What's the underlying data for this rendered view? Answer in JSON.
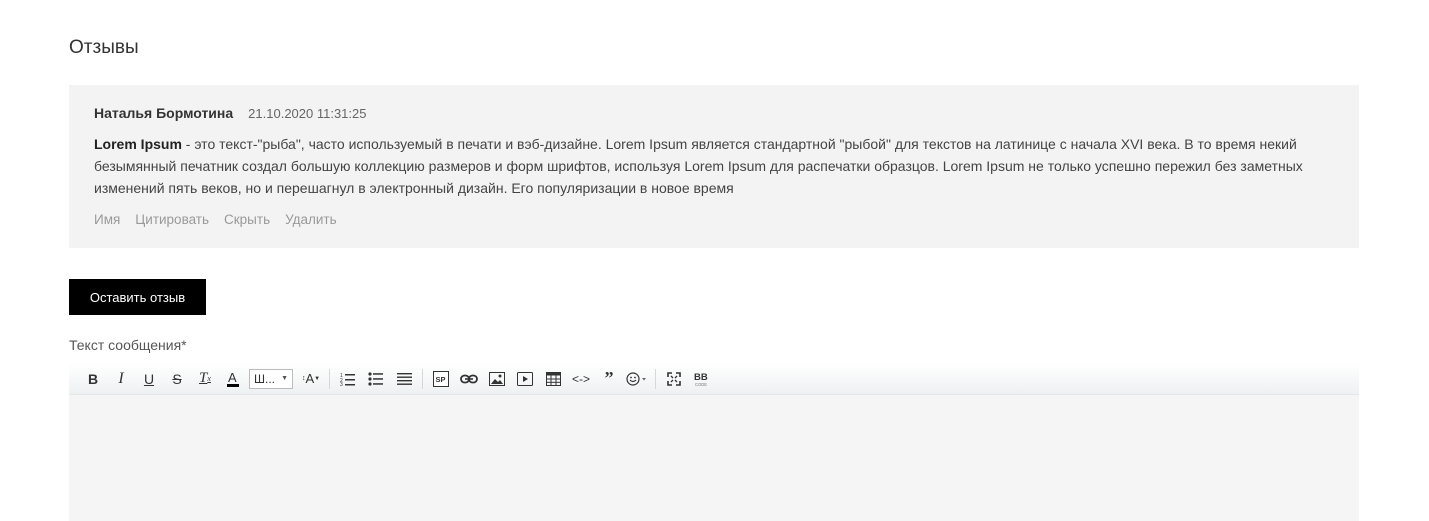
{
  "section": {
    "title": "Отзывы"
  },
  "review": {
    "author": "Наталья Бормотина",
    "date": "21.10.2020 11:31:25",
    "text_bold": "Lorem Ipsum",
    "text_rest": " - это текст-\"рыба\", часто используемый в печати и вэб-дизайне. Lorem Ipsum является стандартной \"рыбой\" для текстов на латинице с начала XVI века. В то время некий безымянный печатник создал большую коллекцию размеров и форм шрифтов, используя Lorem Ipsum для распечатки образцов. Lorem Ipsum не только успешно пережил без заметных изменений пять веков, но и перешагнул в электронный дизайн. Его популяризации в новое время",
    "actions": {
      "name": "Имя",
      "quote": "Цитировать",
      "hide": "Скрыть",
      "delete": "Удалить"
    }
  },
  "form": {
    "leave_button": "Оставить отзыв",
    "message_label": "Текст сообщения*",
    "font_select_value": "Ш..."
  },
  "toolbar_icons": [
    "bold-icon",
    "italic-icon",
    "underline-icon",
    "strikethrough-icon",
    "remove-format-icon",
    "text-color-icon",
    "font-select",
    "font-size-icon",
    "ordered-list-icon",
    "unordered-list-icon",
    "justify-icon",
    "spoiler-icon",
    "link-icon",
    "image-icon",
    "video-icon",
    "table-icon",
    "code-icon",
    "quote-icon",
    "smile-icon",
    "fullscreen-icon",
    "bbcode-icon"
  ],
  "colors": {
    "button_bg": "#000000",
    "review_bg": "#f3f3f3",
    "muted": "#999999"
  }
}
